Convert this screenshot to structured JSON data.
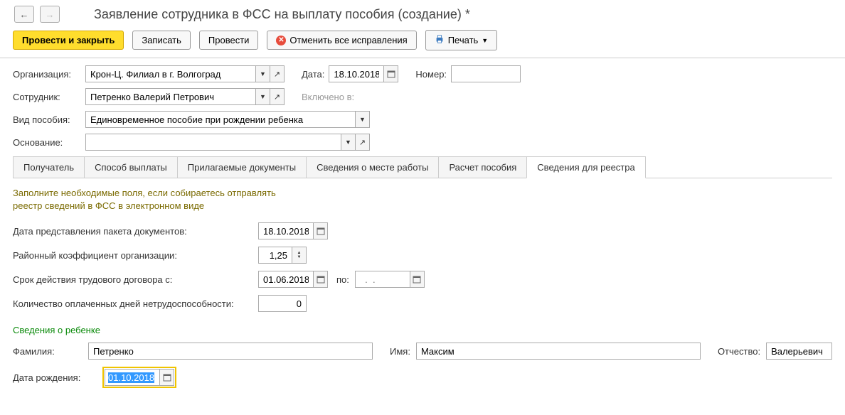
{
  "header": {
    "title": "Заявление сотрудника в ФСС на выплату пособия (создание) *"
  },
  "toolbar": {
    "post_and_close": "Провести и закрыть",
    "save": "Записать",
    "post": "Провести",
    "cancel_corrections": "Отменить все исправления",
    "print": "Печать"
  },
  "form": {
    "org_label": "Организация:",
    "org_value": "Крон-Ц. Филиал в г. Волгоград",
    "date_label": "Дата:",
    "date_value": "18.10.2018",
    "number_label": "Номер:",
    "number_value": "",
    "employee_label": "Сотрудник:",
    "employee_value": "Петренко Валерий Петрович",
    "included_label": "Включено в:",
    "benefit_type_label": "Вид пособия:",
    "benefit_type_value": "Единовременное пособие при рождении ребенка",
    "basis_label": "Основание:",
    "basis_value": ""
  },
  "tabs": {
    "t0": "Получатель",
    "t1": "Способ выплаты",
    "t2": "Прилагаемые документы",
    "t3": "Сведения о месте работы",
    "t4": "Расчет пособия",
    "t5": "Сведения для реестра"
  },
  "registry": {
    "hint_line1": "Заполните необходимые поля, если собираетесь отправлять",
    "hint_line2": "реестр сведений в ФСС в электронном виде",
    "doc_pack_date_label": "Дата представления пакета документов:",
    "doc_pack_date_value": "18.10.2018",
    "district_coef_label": "Районный коэффициент организации:",
    "district_coef_value": "1,25",
    "contract_from_label": "Срок действия трудового договора с:",
    "contract_from_value": "01.06.2018",
    "contract_to_label": "по:",
    "contract_to_placeholder": "  .  .    ",
    "paid_days_label": "Количество оплаченных дней нетрудоспособности:",
    "paid_days_value": "0",
    "child_section": "Сведения о ребенке",
    "surname_label": "Фамилия:",
    "surname_value": "Петренко",
    "name_label": "Имя:",
    "name_value": "Максим",
    "patronymic_label": "Отчество:",
    "patronymic_value": "Валерьевич",
    "birthdate_label": "Дата рождения:",
    "birthdate_value": "01.10.2018"
  }
}
